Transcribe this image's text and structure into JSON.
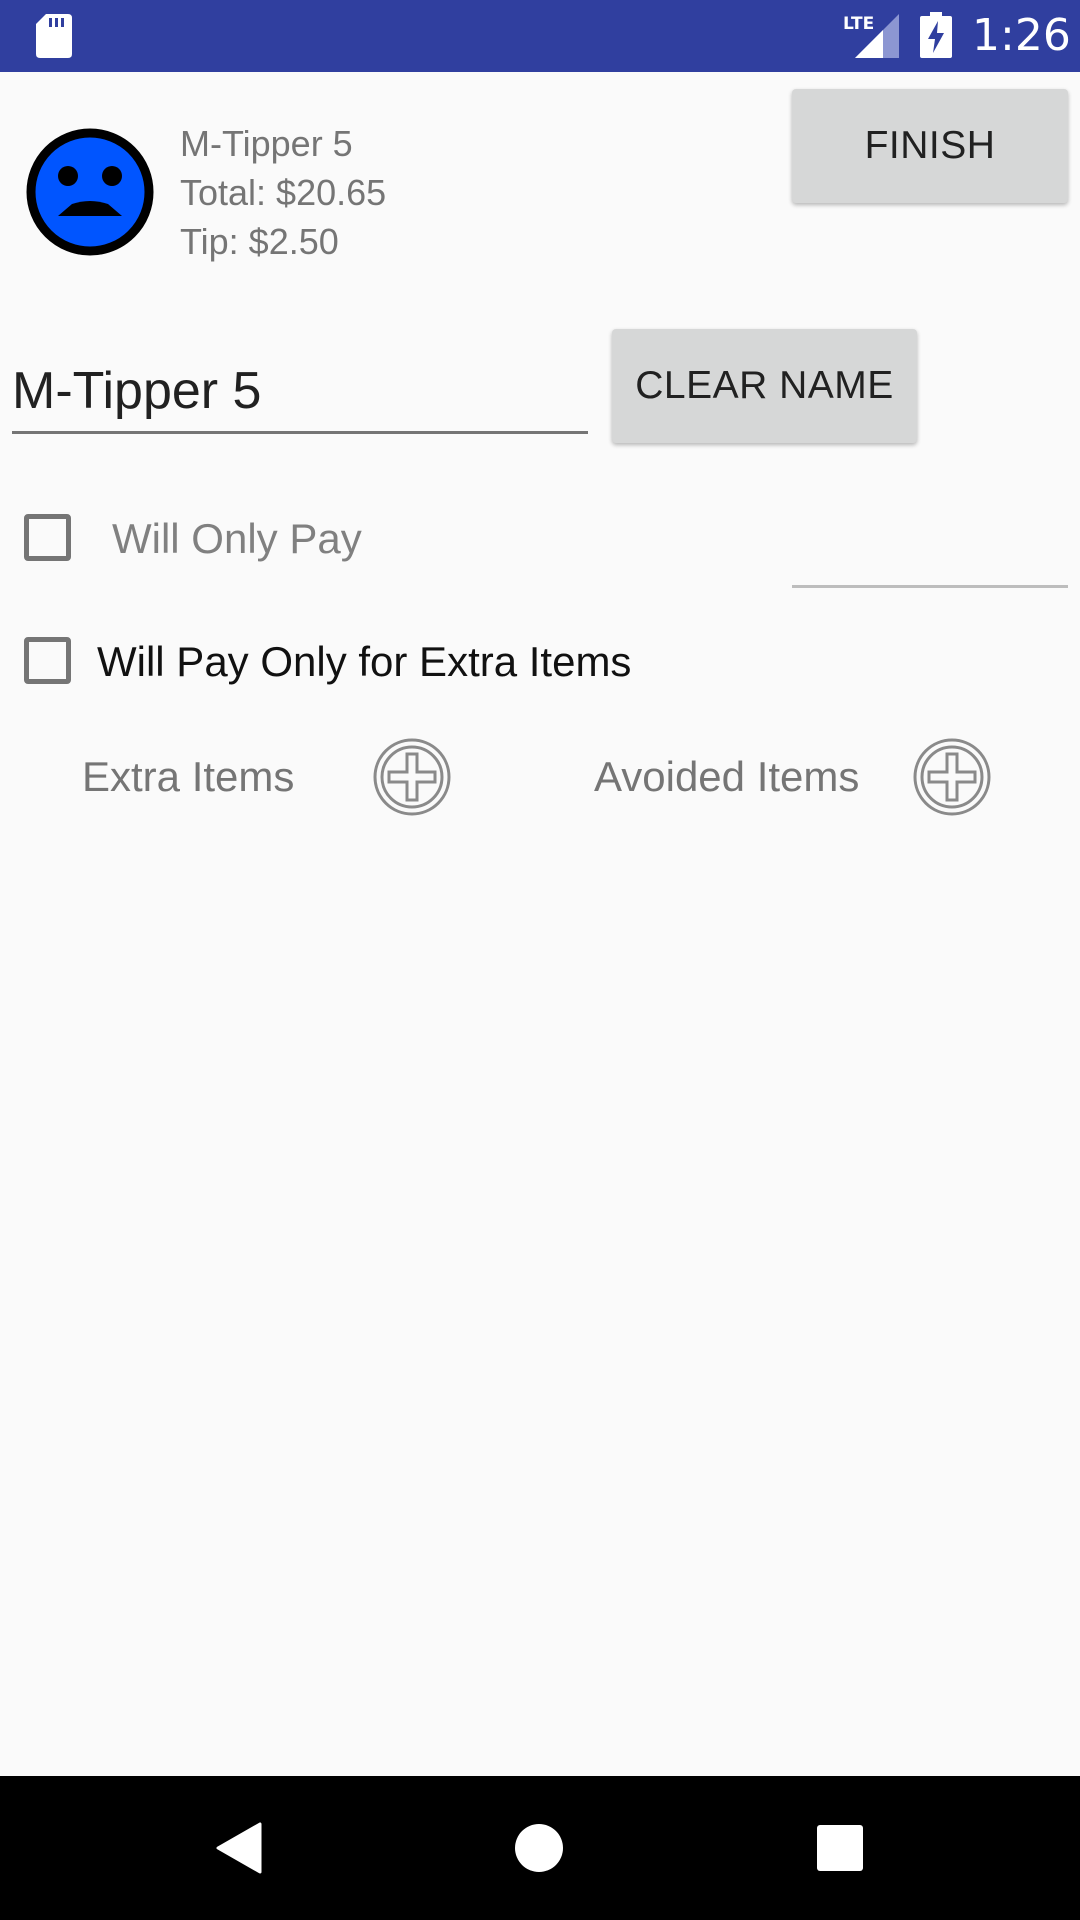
{
  "status_bar": {
    "time": "1:26",
    "network": "LTE",
    "icons": [
      "sd-card-icon",
      "signal-icon",
      "battery-charging-icon"
    ],
    "background_color": "#303f9f"
  },
  "header": {
    "avatar_icon": "blue-sad-face-icon",
    "avatar_color": "#0055ff",
    "name": "M-Tipper 5",
    "total": "Total: $20.65",
    "tip": "Tip: $2.50",
    "finish_label": "FINISH"
  },
  "name_field": {
    "value": "M-Tipper 5",
    "clear_label": "CLEAR NAME"
  },
  "options": {
    "will_only_pay": {
      "label": "Will Only Pay",
      "checked": false,
      "amount_value": ""
    },
    "pay_only_extra": {
      "label": "Will Pay Only for Extra Items",
      "checked": false
    }
  },
  "items": {
    "extra_label": "Extra Items",
    "avoided_label": "Avoided Items",
    "add_icon": "add-circle-icon"
  },
  "nav_bar": {
    "buttons": [
      "back-icon",
      "home-icon",
      "recents-icon"
    ]
  }
}
